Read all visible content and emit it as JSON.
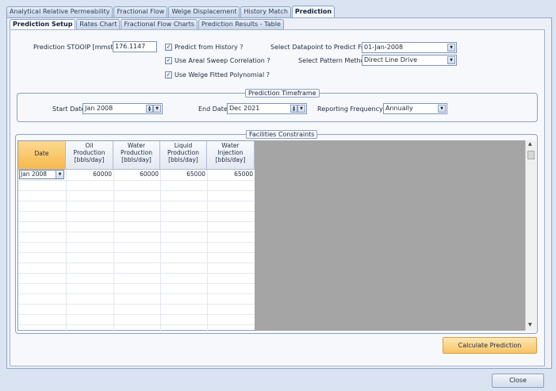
{
  "main_tabs": [
    {
      "label": "Analytical Relative Permeability"
    },
    {
      "label": "Fractional Flow"
    },
    {
      "label": "Welge Displacement"
    },
    {
      "label": "History Match"
    },
    {
      "label": "Prediction"
    }
  ],
  "sub_tabs": [
    {
      "label": "Prediction Setup"
    },
    {
      "label": "Rates Chart"
    },
    {
      "label": "Fractional Flow Charts"
    },
    {
      "label": "Prediction Results - Table"
    }
  ],
  "setup": {
    "stooip_label": "Prediction STOOIP [mmstb]",
    "stooip_value": "176.1147",
    "predict_from_history_label": "Predict from History ?",
    "predict_from_history_checked": true,
    "areal_sweep_label": "Use Areal Sweep Correlation ?",
    "areal_sweep_checked": true,
    "welge_poly_label": "Use Welge Fitted Polynomial ?",
    "welge_poly_checked": true,
    "datapoint_label": "Select Datapoint to Predict From",
    "datapoint_value": "01-Jan-2008",
    "pattern_label": "Select Pattern Method",
    "pattern_value": "Direct Line Drive"
  },
  "timeframe": {
    "title": "Prediction Timeframe",
    "start_label": "Start Date",
    "start_value": "Jan 2008",
    "end_label": "End Date",
    "end_value": "Dec 2021",
    "frequency_label": "Reporting Frequency",
    "frequency_value": "Annually"
  },
  "facilities": {
    "title": "Facilities Constraints",
    "headers": [
      {
        "line1": "Date",
        "line2": "",
        "line3": ""
      },
      {
        "line1": "Oil",
        "line2": "Production",
        "line3": "[bbls/day]"
      },
      {
        "line1": "Water",
        "line2": "Production",
        "line3": "[bbls/day]"
      },
      {
        "line1": "Liquid",
        "line2": "Production",
        "line3": "[bbls/day]"
      },
      {
        "line1": "Water",
        "line2": "Injection",
        "line3": "[bbls/day]"
      }
    ],
    "rows": [
      {
        "date": "Jan 2008",
        "oil": "60000",
        "water": "60000",
        "liquid": "65000",
        "injection": "65000"
      }
    ]
  },
  "buttons": {
    "calculate": "Calculate Prediction",
    "close": "Close"
  },
  "colors": {
    "accent_selected_header": "#f6b94c",
    "calculate_button": "#f8c465",
    "panel_background": "#edf1f7"
  }
}
